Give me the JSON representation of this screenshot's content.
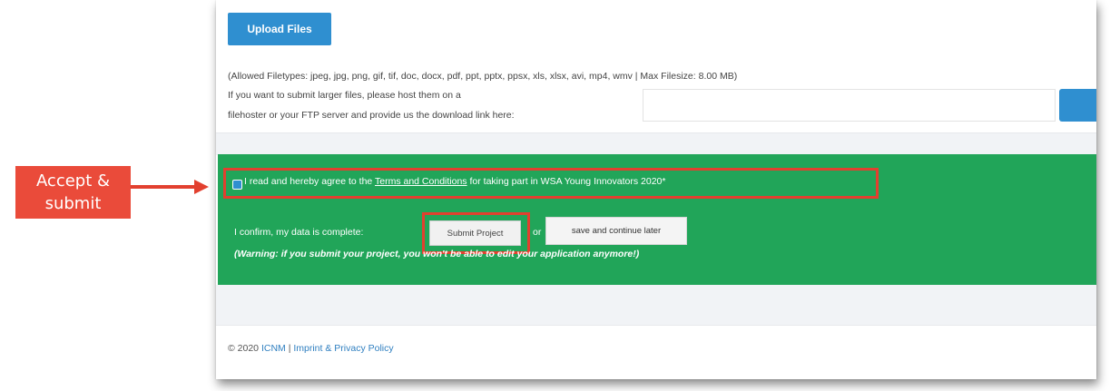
{
  "upload": {
    "button_label": "Upload Files",
    "allowed_text": "(Allowed Filetypes: jpeg, jpg, png, gif, tif, doc, docx, pdf, ppt, pptx, ppsx, xls, xlsx, avi, mp4, wmv | Max Filesize: 8.00 MB)",
    "larger_line1": "If you want to submit larger files, please host them on a",
    "larger_line2": "filehoster or your FTP server and provide us the download link here:",
    "download_link_value": ""
  },
  "terms": {
    "prefix": "I read and hereby agree to the ",
    "link": "Terms and Conditions",
    "suffix": " for taking part in WSA Young Innovators 2020*"
  },
  "confirm": {
    "label": "I confirm, my data is complete:",
    "submit_label": "Submit Project",
    "or_text": "or",
    "later_label": "save and continue later",
    "warning": "(Warning: if you submit your project, you won't be able to edit your application anymore!)"
  },
  "footer": {
    "copyright": "© 2020",
    "org": "ICNM",
    "separator": " | ",
    "policy": "Imprint & Privacy Policy"
  },
  "annotation": {
    "callout_line1": "Accept &",
    "callout_line2": "submit"
  },
  "colors": {
    "primary_blue": "#2f8fd0",
    "success_green": "#21a559",
    "highlight_red": "#e2402f"
  }
}
